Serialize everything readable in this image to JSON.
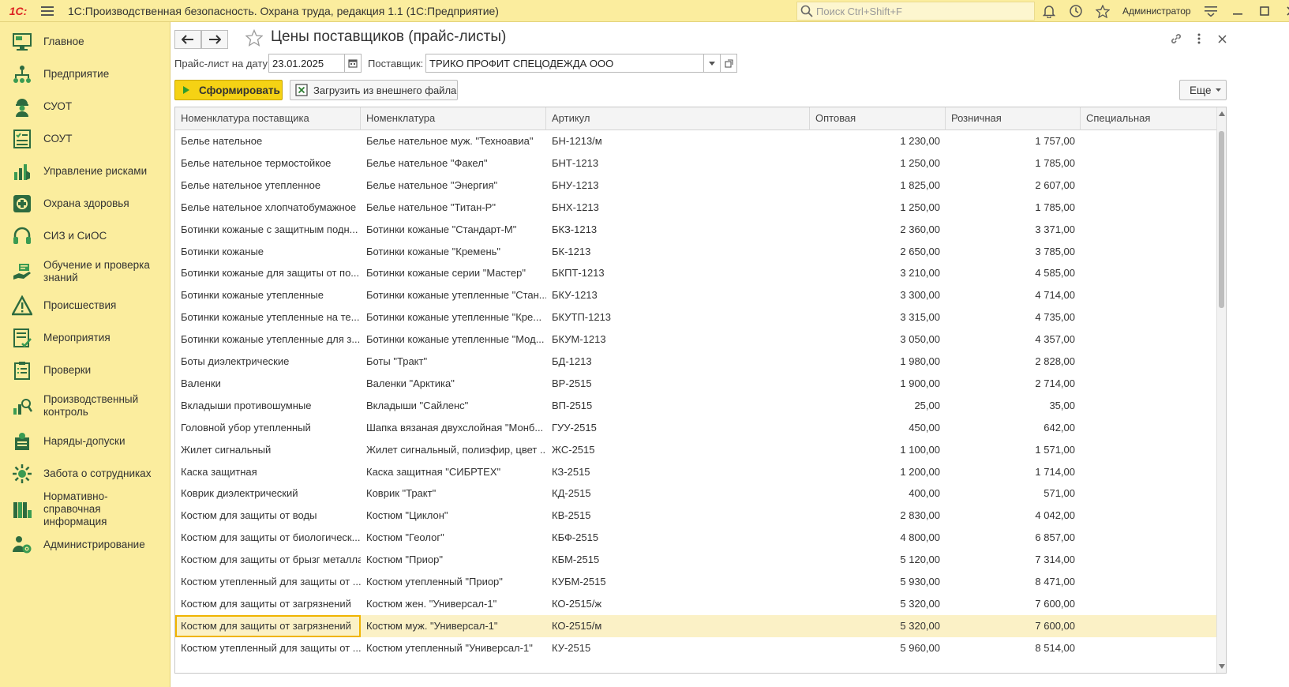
{
  "app": {
    "logo": "1С:",
    "title": "1С:Производственная безопасность. Охрана труда, редакция 1.1  (1С:Предприятие)",
    "search_placeholder": "Поиск Ctrl+Shift+F",
    "user": "Администратор"
  },
  "sidebar": {
    "items": [
      {
        "label": "Главное",
        "icon": "monitor-icon"
      },
      {
        "label": "Предприятие",
        "icon": "org-structure-icon"
      },
      {
        "label": "СУОТ",
        "icon": "worker-icon"
      },
      {
        "label": "СОУТ",
        "icon": "checklist-icon"
      },
      {
        "label": "Управление рисками",
        "icon": "risk-chart-icon"
      },
      {
        "label": "Охрана здоровья",
        "icon": "health-cross-icon"
      },
      {
        "label": "СИЗ и СиОС",
        "icon": "headphones-icon"
      },
      {
        "label": "Обучение и проверка знаний",
        "icon": "training-icon"
      },
      {
        "label": "Происшествия",
        "icon": "warning-icon"
      },
      {
        "label": "Мероприятия",
        "icon": "tasks-icon"
      },
      {
        "label": "Проверки",
        "icon": "clipboard-icon"
      },
      {
        "label": "Производственный контроль",
        "icon": "control-icon"
      },
      {
        "label": "Наряды-допуски",
        "icon": "permit-icon"
      },
      {
        "label": "Забота о сотрудниках",
        "icon": "care-icon"
      },
      {
        "label": "Нормативно-справочная информация",
        "icon": "reference-books-icon"
      },
      {
        "label": "Администрирование",
        "icon": "admin-gear-icon"
      }
    ]
  },
  "form": {
    "title": "Цены поставщиков (прайс-листы)",
    "date_label": "Прайс-лист на дату:",
    "date_value": "23.01.2025",
    "supplier_label": "Поставщик:",
    "supplier_value": "ТРИКО ПРОФИТ СПЕЦОДЕЖДА ООО",
    "generate_button": "Сформировать",
    "load_button": "Загрузить из внешнего файла",
    "more_button": "Еще"
  },
  "table": {
    "columns": [
      "Номенклатура поставщика",
      "Номенклатура",
      "Артикул",
      "Оптовая",
      "Розничная",
      "Специальная"
    ],
    "rows": [
      [
        "Белье нательное",
        "Белье нательное муж. \"Техноавиа\"",
        "БН-1213/м",
        "1 230,00",
        "1 757,00",
        ""
      ],
      [
        "Белье нательное термостойкое",
        "Белье нательное \"Факел\"",
        "БНТ-1213",
        "1 250,00",
        "1 785,00",
        ""
      ],
      [
        "Белье нательное утепленное",
        "Белье нательное \"Энергия\"",
        "БНУ-1213",
        "1 825,00",
        "2 607,00",
        ""
      ],
      [
        "Белье нательное хлопчатобумажное",
        "Белье нательное \"Титан-Р\"",
        "БНХ-1213",
        "1 250,00",
        "1 785,00",
        ""
      ],
      [
        "Ботинки кожаные с защитным подн...",
        "Ботинки кожаные \"Стандарт-М\"",
        "БКЗ-1213",
        "2 360,00",
        "3 371,00",
        ""
      ],
      [
        "Ботинки кожаные",
        "Ботинки кожаные \"Кремень\"",
        "БК-1213",
        "2 650,00",
        "3 785,00",
        ""
      ],
      [
        "Ботинки кожаные для защиты от по...",
        "Ботинки кожаные серии \"Мастер\"",
        "БКПТ-1213",
        "3 210,00",
        "4 585,00",
        ""
      ],
      [
        "Ботинки кожаные утепленные",
        "Ботинки кожаные утепленные \"Стан...",
        "БКУ-1213",
        "3 300,00",
        "4 714,00",
        ""
      ],
      [
        "Ботинки кожаные утепленные на те...",
        "Ботинки кожаные утепленные \"Кре...",
        "БКУТП-1213",
        "3 315,00",
        "4 735,00",
        ""
      ],
      [
        "Ботинки кожаные утепленные для з...",
        "Ботинки кожаные утепленные \"Мод...",
        "БКУМ-1213",
        "3 050,00",
        "4 357,00",
        ""
      ],
      [
        "Боты диэлектрические",
        "Боты \"Тракт\"",
        "БД-1213",
        "1 980,00",
        "2 828,00",
        ""
      ],
      [
        "Валенки",
        "Валенки \"Арктика\"",
        "ВР-2515",
        "1 900,00",
        "2 714,00",
        ""
      ],
      [
        "Вкладыши противошумные",
        "Вкладыши \"Сайленс\"",
        "ВП-2515",
        "25,00",
        "35,00",
        ""
      ],
      [
        "Головной убор утепленный",
        "Шапка вязаная двухслойная \"Монб...",
        "ГУУ-2515",
        "450,00",
        "642,00",
        ""
      ],
      [
        "Жилет сигнальный",
        "Жилет сигнальный, полиэфир, цвет ...",
        "ЖС-2515",
        "1 100,00",
        "1 571,00",
        ""
      ],
      [
        "Каска защитная",
        "Каска защитная \"СИБРТЕХ\"",
        "КЗ-2515",
        "1 200,00",
        "1 714,00",
        ""
      ],
      [
        "Коврик диэлектрический",
        "Коврик \"Тракт\"",
        "КД-2515",
        "400,00",
        "571,00",
        ""
      ],
      [
        "Костюм для защиты от воды",
        "Костюм \"Циклон\"",
        "КВ-2515",
        "2 830,00",
        "4 042,00",
        ""
      ],
      [
        "Костюм для защиты от биологическ...",
        "Костюм \"Геолог\"",
        "КБФ-2515",
        "4 800,00",
        "6 857,00",
        ""
      ],
      [
        "Костюм для защиты от брызг металла",
        "Костюм \"Приор\"",
        "КБМ-2515",
        "5 120,00",
        "7 314,00",
        ""
      ],
      [
        "Костюм утепленный для защиты от ...",
        "Костюм утепленный \"Приор\"",
        "КУБМ-2515",
        "5 930,00",
        "8 471,00",
        ""
      ],
      [
        "Костюм для защиты от загрязнений",
        "Костюм жен. \"Универсал-1\"",
        "КО-2515/ж",
        "5 320,00",
        "7 600,00",
        ""
      ],
      [
        "Костюм для защиты от загрязнений",
        "Костюм муж. \"Универсал-1\"",
        "КО-2515/м",
        "5 320,00",
        "7 600,00",
        ""
      ],
      [
        "Костюм утепленный для защиты от ...",
        "Костюм утепленный \"Универсал-1\"",
        "КУ-2515",
        "5 960,00",
        "8 514,00",
        ""
      ]
    ],
    "selected_row": 22
  }
}
